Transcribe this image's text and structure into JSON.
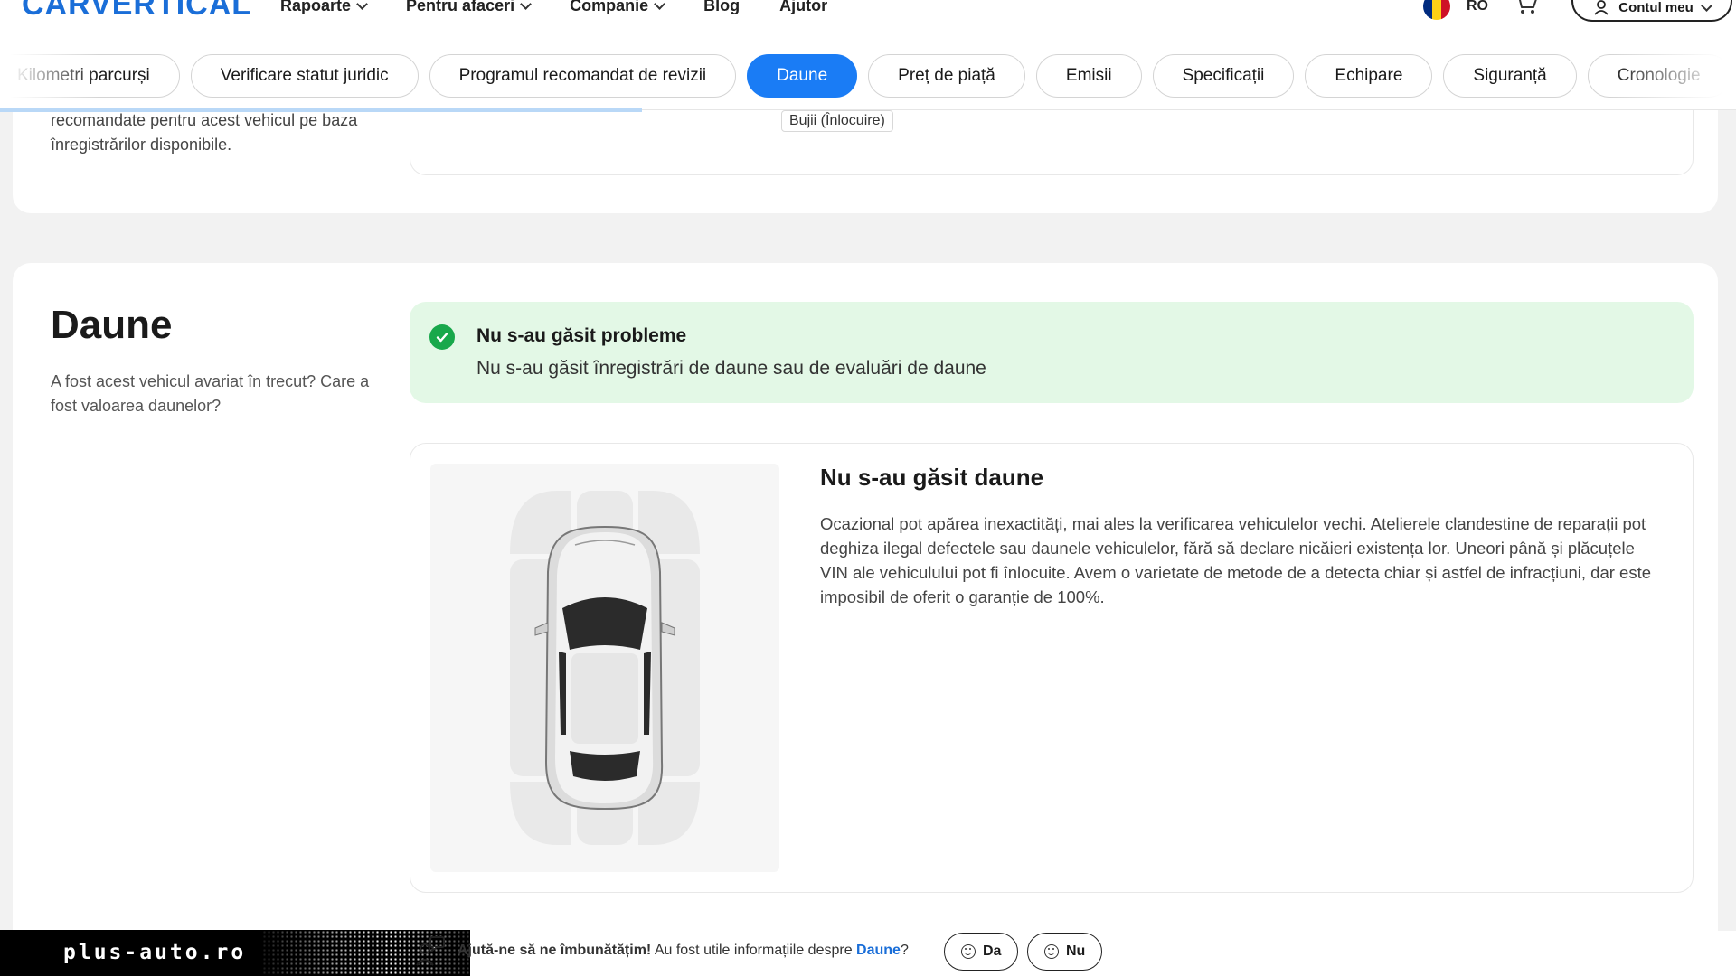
{
  "header": {
    "logo": "CARVERTICAL",
    "nav": [
      {
        "label": "Rapoarte"
      },
      {
        "label": "Pentru afaceri"
      },
      {
        "label": "Companie"
      },
      {
        "label": "Blog"
      },
      {
        "label": "Ajutor"
      }
    ],
    "language": "RO",
    "account_label": "Contul meu"
  },
  "tabs": [
    {
      "label": "Kilometri parcurși"
    },
    {
      "label": "Verificare statut juridic"
    },
    {
      "label": "Programul recomandat de revizii"
    },
    {
      "label": "Daune",
      "active": true
    },
    {
      "label": "Preț de piață"
    },
    {
      "label": "Emisii"
    },
    {
      "label": "Specificații"
    },
    {
      "label": "Echipare"
    },
    {
      "label": "Siguranță"
    },
    {
      "label": "Cronologie"
    }
  ],
  "scroll_progress_percent": 37,
  "previous_section": {
    "description": "recomandate pentru acest vehicul pe baza înregistrărilor disponibile.",
    "chip": "Bujii (Înlocuire)"
  },
  "damage_section": {
    "title": "Daune",
    "description": "A fost acest vehicul avariat în trecut? Care a fost valoarea daunelor?",
    "alert": {
      "title": "Nu s-au găsit probleme",
      "text": "Nu s-au găsit înregistrări de daune sau de evaluări de daune"
    },
    "result_title": "Nu s-au găsit daune",
    "result_text": "Ocazional pot apărea inexactități, mai ales la verificarea vehiculelor vechi. Atelierele clandestine de reparații pot deghiza ilegal defectele sau daunele vehiculelor, fără să declare nicăieri existența lor. Uneori până și plăcuțele VIN ale vehiculului pot fi înlocuite. Avem o varietate de metode de a detecta chiar și astfel de infracțiuni, dar este imposibil de oferit o garanție de 100%."
  },
  "feedback": {
    "prompt_bold": "Ajută-ne să ne îmbunătățim!",
    "question_prefix": "Au fost utile informațiile despre",
    "question_link": "Daune",
    "question_suffix": "?",
    "yes_label": "Da",
    "no_label": "Nu"
  },
  "watermark": "plus-auto.ro",
  "colors": {
    "accent": "#1a7cf5",
    "success": "#18a84b",
    "success_bg": "#e3f8e6",
    "flag": [
      "#002b7f",
      "#fcd116",
      "#ce1126"
    ]
  }
}
